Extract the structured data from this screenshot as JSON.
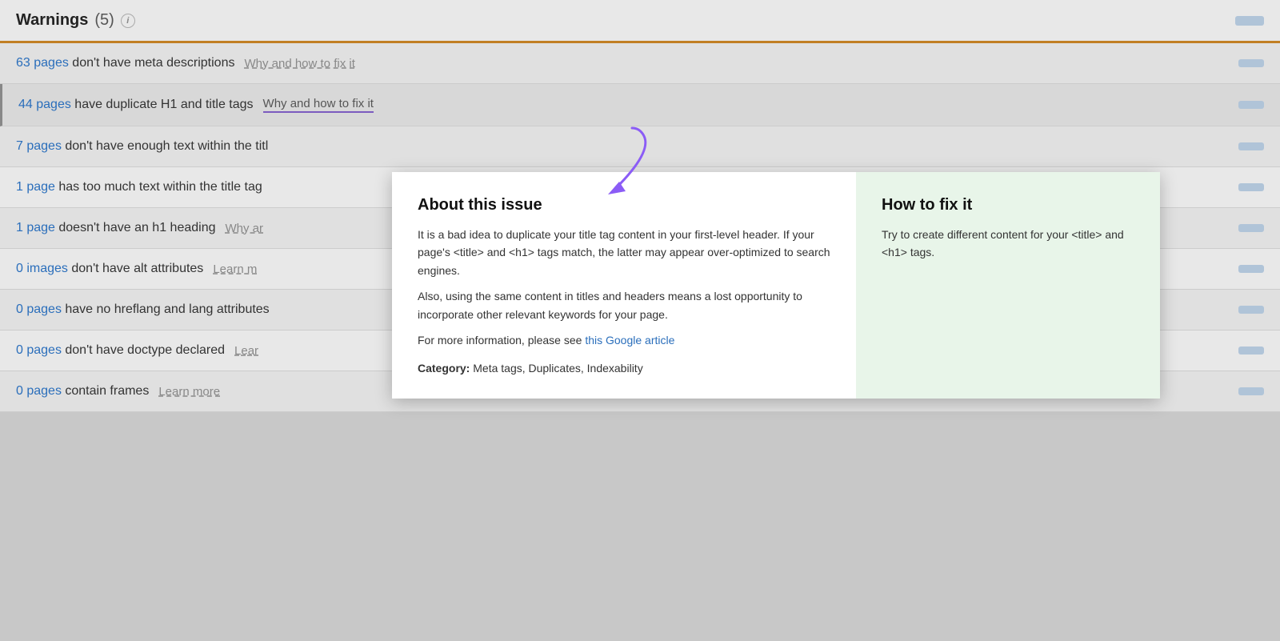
{
  "header": {
    "title": "Warnings",
    "count": "(5)",
    "info_label": "i",
    "button_label": ""
  },
  "rows": [
    {
      "id": "row1",
      "count_text": "63 pages",
      "description": " don't have meta descriptions",
      "why_label": "Why and how to fix it",
      "has_why": true,
      "active": false
    },
    {
      "id": "row2",
      "count_text": "44 pages",
      "description": " have duplicate H1 and title tags",
      "why_label": "Why and how to fix it",
      "has_why": true,
      "active": true
    },
    {
      "id": "row3",
      "count_text": "7 pages",
      "description": " don't have enough text within the titl",
      "why_label": "",
      "has_why": false,
      "active": false
    },
    {
      "id": "row4",
      "count_text": "1 page",
      "description": " has too much text within the title tag",
      "why_label": "",
      "has_why": false,
      "active": false
    },
    {
      "id": "row5",
      "count_text": "1 page",
      "description": " doesn't have an h1 heading",
      "why_label": "Why ar",
      "has_why": true,
      "active": false
    },
    {
      "id": "row6",
      "count_text": "0 images",
      "description": " don't have alt attributes",
      "why_label": "Learn m",
      "has_why": true,
      "active": false
    },
    {
      "id": "row7",
      "count_text": "0 pages",
      "description": " have no hreflang and lang attributes",
      "why_label": "",
      "has_why": false,
      "active": false
    },
    {
      "id": "row8",
      "count_text": "0 pages",
      "description": " don't have doctype declared",
      "why_label": "Lear",
      "has_why": true,
      "active": false
    },
    {
      "id": "row9",
      "count_text": "0 pages",
      "description": " contain frames",
      "why_label": "Learn more",
      "has_why": true,
      "active": false
    }
  ],
  "popup": {
    "left_title": "About this issue",
    "left_body_1": "It is a bad idea to duplicate your title tag content in your first-level header. If your page's <title> and <h1> tags match, the latter may appear over-optimized to search engines.",
    "left_body_2": "Also, using the same content in titles and headers means a lost opportunity to incorporate other relevant keywords for your page.",
    "left_body_3": "For more information, please see ",
    "left_link_text": "this Google article",
    "left_link_url": "#",
    "left_category_label": "Category:",
    "left_category_value": " Meta tags, Duplicates, Indexability",
    "right_title": "How to fix it",
    "right_body": "Try to create different content for your <title> and <h1> tags."
  },
  "arrow": {
    "description": "purple arrow pointing down"
  }
}
